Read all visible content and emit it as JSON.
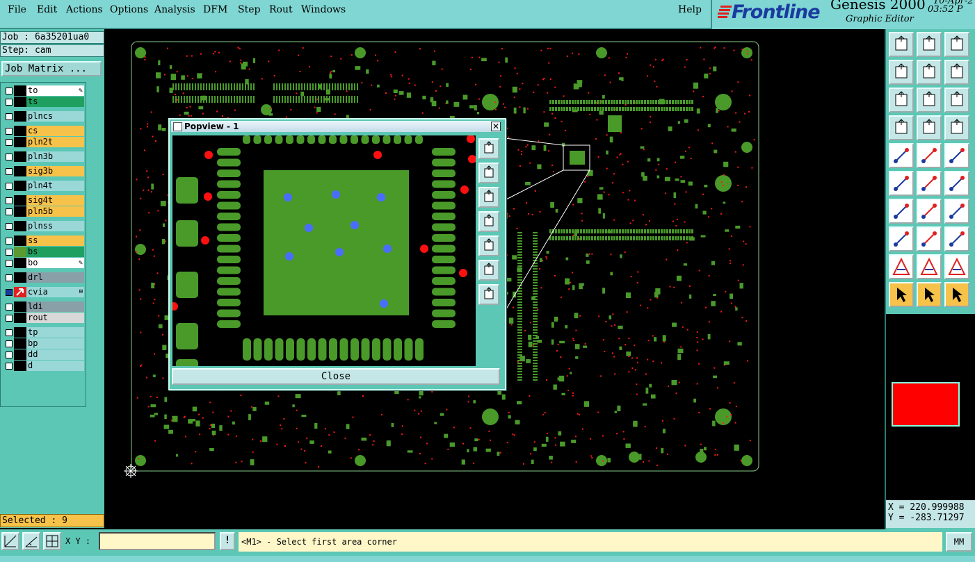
{
  "menubar": {
    "items": [
      "File",
      "Edit",
      "Actions",
      "Options",
      "Analysis",
      "DFM",
      "Step",
      "Rout",
      "Windows"
    ],
    "help": "Help"
  },
  "header": {
    "logo": "Frontline",
    "product": "Genesis 2000",
    "subtitle": "Graphic Editor",
    "date": "10-Apr-2",
    "time": "03:52 P"
  },
  "job": {
    "job_line": "Job : 6a35201ua0",
    "step_line": "Step: cam",
    "matrix_button": "Job Matrix ..."
  },
  "layers": [
    {
      "name": "to",
      "color": "#ffffff",
      "swatch": "#000000",
      "edit": true
    },
    {
      "name": "ts",
      "color": "#20a060",
      "swatch": "#000000"
    },
    {
      "name": "plncs",
      "color": "#9ad8d8",
      "swatch": "#000000"
    },
    {
      "name": "cs",
      "color": "#f7c24a",
      "swatch": "#000000"
    },
    {
      "name": "pln2t",
      "color": "#f7c24a",
      "swatch": "#000000"
    },
    {
      "name": "pln3b",
      "color": "#9ad8d8",
      "swatch": "#000000"
    },
    {
      "name": "sig3b",
      "color": "#f7c24a",
      "swatch": "#000000"
    },
    {
      "name": "pln4t",
      "color": "#9ad8d8",
      "swatch": "#000000"
    },
    {
      "name": "sig4t",
      "color": "#f7c24a",
      "swatch": "#000000"
    },
    {
      "name": "pln5b",
      "color": "#f7c24a",
      "swatch": "#000000"
    },
    {
      "name": "plnss",
      "color": "#9ad8d8",
      "swatch": "#000000"
    },
    {
      "name": "ss",
      "color": "#f7c24a",
      "swatch": "#000000"
    },
    {
      "name": "bs",
      "color": "#20a060",
      "swatch": "#5a9a30"
    },
    {
      "name": "bo",
      "color": "#ffffff",
      "swatch": "#000000",
      "edit": true
    },
    {
      "name": "drl",
      "color": "#8aa0a8",
      "swatch": "#000000"
    },
    {
      "name": "cvia",
      "color": "#9ad8d8",
      "swatch": "#1a3aa0",
      "work": true
    },
    {
      "name": "ldi",
      "color": "#8aa0a8",
      "swatch": "#000000"
    },
    {
      "name": "rout",
      "color": "#d8d8d8",
      "swatch": "#000000"
    },
    {
      "name": "tp",
      "color": "#9ad8d8",
      "swatch": "#000000"
    },
    {
      "name": "bp",
      "color": "#9ad8d8",
      "swatch": "#000000"
    },
    {
      "name": "dd",
      "color": "#9ad8d8",
      "swatch": "#000000"
    },
    {
      "name": "d",
      "color": "#9ad8d8",
      "swatch": "#000000"
    }
  ],
  "selected": "Selected : 9",
  "popview": {
    "title": "Popview - 1",
    "close_x": "✕",
    "close_button": "Close"
  },
  "coords": {
    "x": "X = 220.999988",
    "y": "Y = -283.71297"
  },
  "status": {
    "xy_label": "X Y :",
    "xy_value": "",
    "xy_placeholder": "",
    "message": "<M1> - Select first area corner",
    "units": "MM",
    "warn": "!"
  },
  "colors": {
    "board_green": "#4a9a2a",
    "via_red": "#ff1010",
    "panel": "#5cc7b5",
    "outline": "#88cc88"
  }
}
